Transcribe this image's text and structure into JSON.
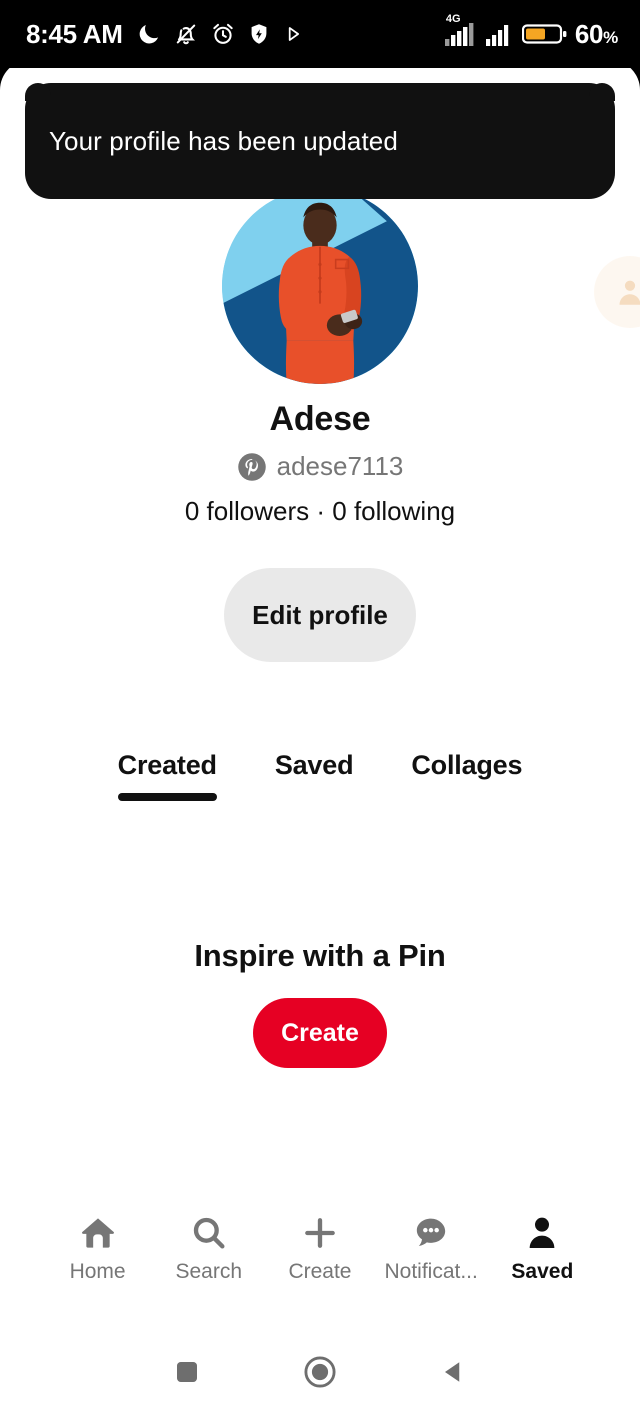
{
  "status_bar": {
    "time": "8:45 AM",
    "battery_percent": "60",
    "percent_sign": "%",
    "network_label": "4G",
    "icons": [
      "do-not-disturb-moon-icon",
      "bell-muted-icon",
      "alarm-clock-icon",
      "shield-lightning-icon",
      "play-triangle-icon"
    ]
  },
  "toast": {
    "message": "Your profile has been updated"
  },
  "profile": {
    "display_name": "Adese",
    "username": "adese7113",
    "username_icon": "pinterest-logo-icon",
    "stats": "0 followers · 0 following",
    "followers_count": "0",
    "following_count": "0",
    "edit_button_label": "Edit profile",
    "avatar_alt": "profile-photo"
  },
  "tabs": [
    {
      "label": "Created",
      "active": true
    },
    {
      "label": "Saved",
      "active": false
    },
    {
      "label": "Collages",
      "active": false
    }
  ],
  "empty_state": {
    "title": "Inspire with a Pin",
    "cta_label": "Create"
  },
  "bottom_nav": [
    {
      "label": "Home",
      "icon": "home-icon",
      "active": false
    },
    {
      "label": "Search",
      "icon": "search-icon",
      "active": false
    },
    {
      "label": "Create",
      "icon": "plus-icon",
      "active": false
    },
    {
      "label": "Notificat...",
      "icon": "chat-bubble-dots-icon",
      "active": false
    },
    {
      "label": "Saved",
      "icon": "person-icon",
      "active": true
    }
  ],
  "system_nav": [
    {
      "name": "recents-square-icon"
    },
    {
      "name": "home-circle-icon"
    },
    {
      "name": "back-triangle-icon"
    }
  ],
  "colors": {
    "brand_red": "#e60023",
    "toast_bg": "#111111",
    "muted_text": "#767676",
    "button_gray": "#e9e9e9",
    "battery_orange": "#f5a623"
  }
}
